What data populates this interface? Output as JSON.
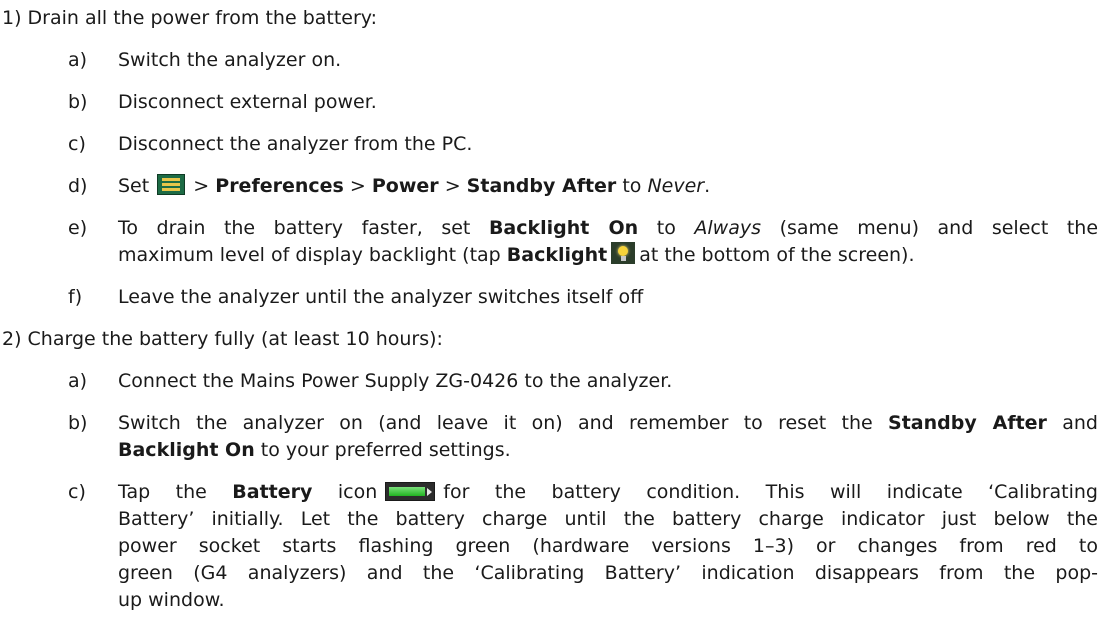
{
  "step1": {
    "title": "1) Drain all the power from the battery:",
    "a": {
      "letter": "a)",
      "text": "Switch the analyzer on."
    },
    "b": {
      "letter": "b)",
      "text": "Disconnect external power."
    },
    "c": {
      "letter": "c)",
      "text": "Disconnect the analyzer from the PC."
    },
    "d": {
      "letter": "d)",
      "set": "Set",
      "sep": ">",
      "preferences": "Preferences",
      "power": "Power",
      "standby_after": "Standby After",
      "to": "to",
      "never": "Never",
      "period": "."
    },
    "e": {
      "letter": "e)",
      "line1_pre": "To drain the battery faster, set",
      "backlight_on": "Backlight On",
      "to": "to",
      "always": "Always",
      "line1_post": "(same menu) and select the",
      "line2_pre": "maximum level of display backlight (tap",
      "backlight": "Backlight",
      "line2_post": "at the bottom of the screen)."
    },
    "f": {
      "letter": "f)",
      "text": "Leave the analyzer until the analyzer switches itself off"
    }
  },
  "step2": {
    "title": "2) Charge the battery fully (at least 10 hours):",
    "a": {
      "letter": "a)",
      "text": "Connect the Mains Power Supply ZG-0426 to the analyzer."
    },
    "b": {
      "letter": "b)",
      "line1_pre": "Switch the analyzer on (and leave it on) and remember to reset the",
      "standby_after": "Standby After",
      "and": "and",
      "backlight_on": "Backlight On",
      "line2_post": "to your preferred settings."
    },
    "c": {
      "letter": "c)",
      "tap": "Tap the",
      "battery": "Battery",
      "line1_post": "icon",
      "line1_end": "for the battery condition. This will indicate ‘Calibrating",
      "line2": "Battery’ initially. Let the battery charge until the battery charge indicator just below the",
      "line3": "power socket starts flashing green (hardware versions 1–3) or changes from red to",
      "line4": "green (G4 analyzers) and the ‘Calibrating Battery’ indication disappears from the pop-",
      "line5": "up window."
    }
  },
  "icons": {
    "menu": "menu-icon",
    "backlight": "backlight-bulb-icon",
    "battery": "battery-icon"
  }
}
